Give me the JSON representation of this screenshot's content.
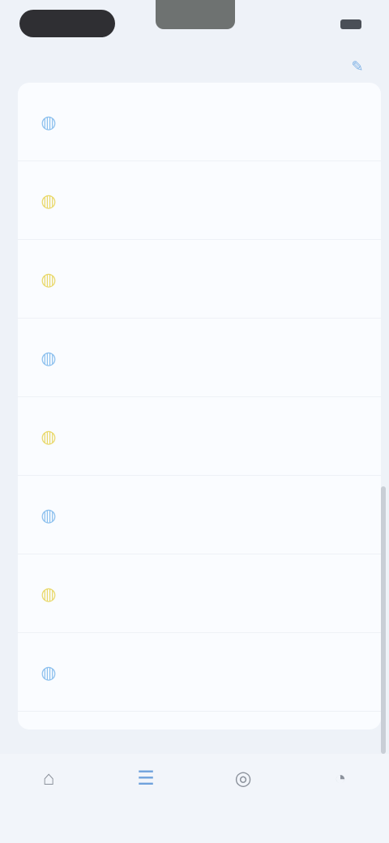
{
  "status": {
    "time": "",
    "battery": ""
  },
  "header": {
    "title": "",
    "action_icon": "edit-icon"
  },
  "list": [
    {
      "icon": "blue-round-icon",
      "title": "",
      "tag": "",
      "subtitle": "",
      "time": "",
      "meta": "",
      "color": "#8cc0ee"
    },
    {
      "icon": "yellow-round-icon",
      "title": "",
      "tag": "",
      "subtitle": "",
      "time": "",
      "meta": "",
      "color": "#e9d86a"
    },
    {
      "icon": "yellow-round-icon",
      "title": "",
      "tag": "",
      "subtitle": "",
      "time": "",
      "meta": "",
      "color": "#e9d86a"
    },
    {
      "icon": "blue-round-icon",
      "title": "",
      "tag": "",
      "subtitle": "",
      "time": "",
      "meta": "",
      "color": "#8cc0ee"
    },
    {
      "icon": "yellow-round-icon",
      "title": "",
      "tag": "",
      "subtitle": "",
      "time": "",
      "meta": "",
      "color": "#e9d86a"
    },
    {
      "icon": "blue-round-icon",
      "title": "",
      "tag": "",
      "subtitle": "",
      "time": "",
      "meta": "",
      "color": "#8cc0ee"
    },
    {
      "icon": "yellow-round-icon",
      "title": "",
      "tag": "",
      "subtitle": "",
      "time": "",
      "meta": "",
      "color": "#e9d86a"
    },
    {
      "icon": "blue-round-icon",
      "title": "",
      "tag": "",
      "subtitle": "",
      "time": "",
      "meta": "",
      "color": "#8cc0ee"
    }
  ],
  "nav": [
    {
      "icon": "home-icon",
      "label": "",
      "active": false
    },
    {
      "icon": "list-icon",
      "label": "",
      "active": true
    },
    {
      "icon": "compass-icon",
      "label": "",
      "active": false
    },
    {
      "icon": "profile-icon",
      "label": "",
      "active": false
    }
  ],
  "colors": {
    "accent": "#6fa2dc",
    "background": "#eef2f8",
    "card": "#fafcff"
  }
}
